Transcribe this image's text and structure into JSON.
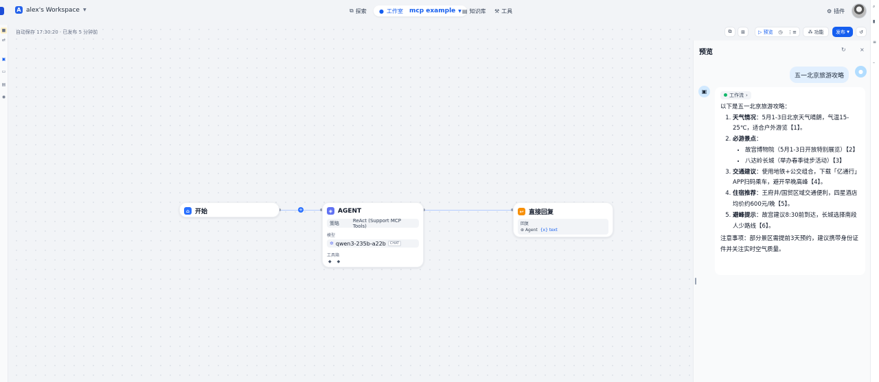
{
  "header": {
    "workspace_initial": "A",
    "workspace_name": "alex's Workspace",
    "nav": {
      "explore": "探索",
      "studio": "工作室",
      "app_name": "mcp example",
      "knowledge": "知识库",
      "tools": "工具"
    },
    "plugins": "插件"
  },
  "canvas": {
    "autosave": "自动保存 17:30:20 · 已发布 5 分钟前"
  },
  "toolbar": {
    "preview": "预览",
    "features": "功能",
    "publish": "发布"
  },
  "nodes": {
    "start": {
      "title": "开始"
    },
    "agent": {
      "title": "AGENT",
      "strategy_label": "策略",
      "strategy_value": "ReAct (Support MCP Tools)",
      "model_label": "模型",
      "model_value": "qwen3-235b-a22b",
      "model_badge": "CHAT",
      "tools_label": "工具箱"
    },
    "answer": {
      "title": "直接回复",
      "reply_label": "回复",
      "var_source": "Agent",
      "var_name": "text"
    }
  },
  "preview": {
    "title": "预览",
    "user_message": "五一北京旅游攻略",
    "workflow_tag": "工作流",
    "intro": "以下是五一北京旅游攻略：",
    "items": [
      {
        "label": "天气情况",
        "text": "：5月1-3日北京天气晴朗，气温15-25℃，适合户外游览【1】。"
      },
      {
        "label": "必游景点",
        "text": "："
      },
      {
        "label": "交通建议",
        "text": "：使用地铁+公交组合，下载「亿通行」APP扫码乘车，避开早晚高峰【4】。"
      },
      {
        "label": "住宿推荐",
        "text": "：王府井/国贸区域交通便利，四星酒店均价约600元/晚【5】。"
      },
      {
        "label": "避峰提示",
        "text": "：故宫建议8:30前到达，长城选择南段人少路线【6】。"
      }
    ],
    "sights": [
      "故宫博物院（5月1-3日开放特别展览）【2】",
      "八达岭长城（举办春季徒步活动）【3】"
    ],
    "note": "注意事项：部分景区需提前3天预约，建议携带身份证件并关注实时空气质量。"
  },
  "colors": {
    "accent": "#155eef",
    "start_icon": "#2970ff",
    "agent_icon": "#6172f3",
    "answer_icon": "#f79009"
  }
}
